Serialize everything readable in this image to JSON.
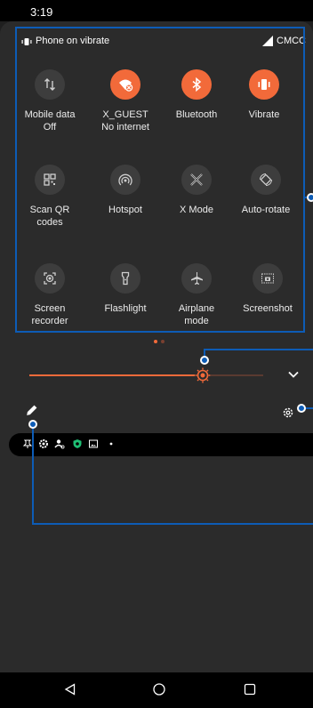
{
  "status_bar": {
    "time": "3:19"
  },
  "header": {
    "ringer_status": "Phone on vibrate",
    "carrier": "CMCC"
  },
  "tiles": [
    {
      "label": "Mobile data",
      "sub": "Off",
      "icon": "mobile-data-icon",
      "active": false
    },
    {
      "label": "X_GUEST",
      "sub": "No internet",
      "icon": "wifi-off-icon",
      "active": true
    },
    {
      "label": "Bluetooth",
      "sub": "",
      "icon": "bluetooth-icon",
      "active": true
    },
    {
      "label": "Vibrate",
      "sub": "",
      "icon": "vibrate-icon",
      "active": true
    },
    {
      "label": "Scan QR",
      "sub": "codes",
      "icon": "qr-icon",
      "active": false
    },
    {
      "label": "Hotspot",
      "sub": "",
      "icon": "hotspot-icon",
      "active": false
    },
    {
      "label": "X Mode",
      "sub": "",
      "icon": "x-mode-icon",
      "active": false
    },
    {
      "label": "Auto-rotate",
      "sub": "",
      "icon": "auto-rotate-icon",
      "active": false
    },
    {
      "label": "Screen",
      "sub": "recorder",
      "icon": "screen-recorder-icon",
      "active": false
    },
    {
      "label": "Flashlight",
      "sub": "",
      "icon": "flashlight-icon",
      "active": false
    },
    {
      "label": "Airplane",
      "sub": "mode",
      "icon": "airplane-icon",
      "active": false
    },
    {
      "label": "Screenshot",
      "sub": "",
      "icon": "screenshot-icon",
      "active": false
    }
  ],
  "brightness": {
    "level": 0.74
  },
  "colors": {
    "accent": "#f26a3a",
    "tile_off": "#3d3d3d",
    "panel": "#2b2b2b",
    "annotation": "#0d5cb6"
  },
  "pager": {
    "pages": 2,
    "current": 1
  }
}
